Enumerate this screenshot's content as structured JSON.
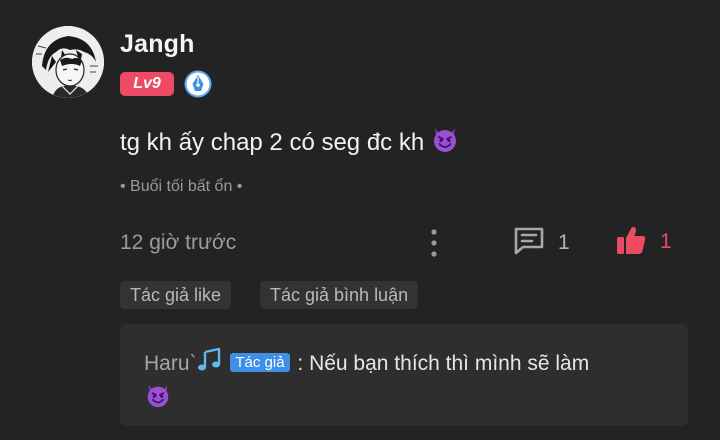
{
  "comment": {
    "username": "Jangh",
    "level_badge": "Lv9",
    "text": "tg kh ấy chap 2 có seg đc kh",
    "text_emoji": "smiling-devil-emoji",
    "chapter_tag": "• Buổi tối bất ổn •",
    "timestamp": "12 giờ trước",
    "reply_count": "1",
    "like_count": "1",
    "like_color": "#ec4b63",
    "level_color": "#ec4b63"
  },
  "chips": {
    "author_like": "Tác giả like",
    "author_reply": "Tác giả bình luận"
  },
  "reply": {
    "author": "Haru`",
    "author_icon": "musical-notes-icon",
    "author_badge": "Tác giả",
    "separator": " : ",
    "text": "Nếu bạn thích thì mình sẽ làm",
    "emoji": "smiling-devil-emoji",
    "badge_color": "#3f8fe6"
  }
}
